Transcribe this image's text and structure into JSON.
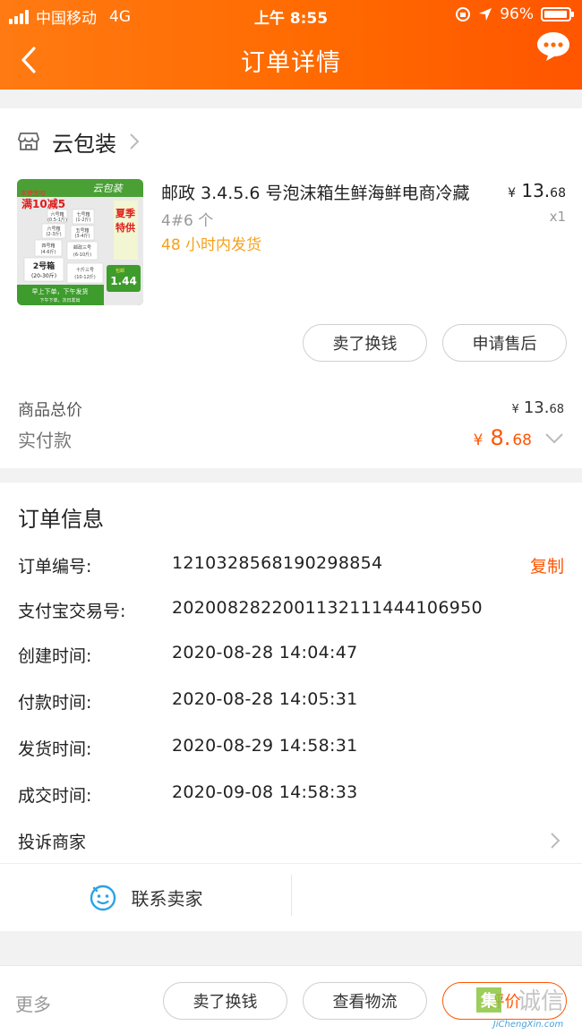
{
  "status_bar": {
    "carrier": "中国移动",
    "network": "4G",
    "time": "上午 8:55",
    "battery": "96%",
    "battery_level": 0.96
  },
  "nav": {
    "title": "订单详情",
    "back_icon": "back-chevron-icon",
    "more_icon": "chat-bubble-icon"
  },
  "shop": {
    "name": "云包装",
    "icon": "store-icon"
  },
  "product": {
    "title": "邮政 3.4.5.6 号泡沫箱生鲜海鲜电商冷藏",
    "spec": "4#6 个",
    "shipping": "48 小时内发货",
    "price_symbol": "¥",
    "price_int": "13.",
    "price_dec": "68",
    "qty": "x1",
    "image": {
      "brand": "云包装",
      "promo": "满10减5",
      "promo_top": "本使宜哈",
      "summer": "夏季特供",
      "box_label": "2号箱",
      "box_size": "(20-30斤)",
      "price": "1.44",
      "price_note": "包邮",
      "bottom_line1": "早上下单，下午发货",
      "bottom_line2": "下午下单，次日发出",
      "boxes": [
        {
          "name": "六号箱",
          "size": "(0.5-1斤)"
        },
        {
          "name": "七号箱",
          "size": "(1-2斤)"
        },
        {
          "name": "六号箱",
          "size": "(2-3斤)"
        },
        {
          "name": "五号箱",
          "size": "(3-4斤)"
        },
        {
          "name": "四号箱",
          "size": "(4-6斤)"
        },
        {
          "name": "邮政三号",
          "size": "(6-10斤)"
        },
        {
          "name": "十斤三号",
          "size": "(10-12斤)"
        }
      ]
    }
  },
  "actions": {
    "sell": "卖了换钱",
    "after_sale": "申请售后"
  },
  "summary": {
    "total_label": "商品总价",
    "total_symbol": "¥",
    "total_int": "13.",
    "total_dec": "68",
    "paid_label": "实付款",
    "paid_symbol": "¥",
    "paid_int": "8.",
    "paid_dec": "68"
  },
  "order_info": {
    "title": "订单信息",
    "rows": [
      {
        "label": "订单编号:",
        "value": "1210328568190298854"
      },
      {
        "label": "支付宝交易号:",
        "value": "2020082822001132111444106950"
      },
      {
        "label": "创建时间:",
        "value": "2020-08-28 14:04:47"
      },
      {
        "label": "付款时间:",
        "value": "2020-08-28 14:05:31"
      },
      {
        "label": "发货时间:",
        "value": "2020-08-29 14:58:31"
      },
      {
        "label": "成交时间:",
        "value": "2020-09-08 14:58:33"
      }
    ],
    "copy": "复制",
    "complaint": "投诉商家",
    "contact": "联系卖家"
  },
  "bottom": {
    "more": "更多",
    "sell": "卖了换钱",
    "logistics": "查看物流",
    "review": "评价"
  },
  "watermark": {
    "text": "JiChengXin.com",
    "icon_char": "集",
    "chars": "诚信"
  },
  "colors": {
    "accent": "#ff5500",
    "header": "#ff6a00",
    "ship": "#f5a11b"
  }
}
